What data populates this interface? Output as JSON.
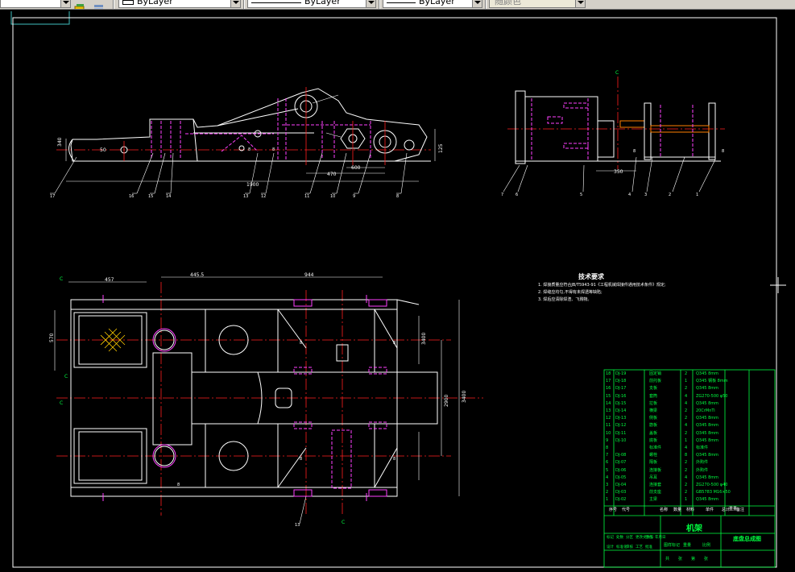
{
  "toolbar": {
    "layer_color_value": "ByLayer",
    "linetype_value": "ByLayer",
    "lineweight_value": "ByLayer",
    "plotstyle_value": "随颜色"
  },
  "drawing": {
    "dims_side": [
      "340",
      "50",
      "1900",
      "470",
      "600",
      "125"
    ],
    "dims_end": [
      "350"
    ],
    "dims_plan": [
      "457",
      "445.5",
      "944",
      "570",
      "3400",
      "2900",
      "3400"
    ],
    "item_labels_side": [
      "17",
      "16",
      "15",
      "14",
      "13",
      "12",
      "11",
      "10",
      "9",
      "8"
    ],
    "item_labels_end": [
      "7",
      "6",
      "5",
      "4",
      "3",
      "2",
      "1"
    ],
    "weld_marks": [
      "8",
      "8",
      "8",
      "8",
      "8",
      "8",
      "8",
      "8",
      "8"
    ],
    "plan_label": "13",
    "section_marks": [
      "C",
      "C",
      "C",
      "C",
      "C"
    ],
    "tech_title": "技术要求",
    "tech_notes": [
      "1. 焊接质量应符合JB/T5943-91《工程机械焊接件通用技术条件》规定;",
      "2. 焊缝应均匀,不得有未焊透等缺陷;",
      "3. 焊后应清除焊渣、飞溅物。"
    ]
  },
  "title_block": {
    "header": [
      "序号",
      "代号",
      "名称",
      "数量",
      "材料",
      "单件",
      "总计",
      "备注"
    ],
    "weight_head": "重量",
    "rows": [
      {
        "no": "18",
        "code": "DJ-19",
        "name": "固定销",
        "qty": "2",
        "mat": "Q345 8mm"
      },
      {
        "no": "17",
        "code": "DJ-18",
        "name": "前托板",
        "qty": "1",
        "mat": "Q345 钢板 8mm"
      },
      {
        "no": "16",
        "code": "DJ-17",
        "name": "支板",
        "qty": "2",
        "mat": "Q345 8mm"
      },
      {
        "no": "15",
        "code": "DJ-16",
        "name": "套筒",
        "qty": "4",
        "mat": "ZG270-500 φ50"
      },
      {
        "no": "14",
        "code": "DJ-15",
        "name": "拉板",
        "qty": "4",
        "mat": "Q345 8mm"
      },
      {
        "no": "13",
        "code": "DJ-14",
        "name": "横梁",
        "qty": "2",
        "mat": "20CrMnTi"
      },
      {
        "no": "12",
        "code": "DJ-13",
        "name": "侧板",
        "qty": "2",
        "mat": "Q345 8mm"
      },
      {
        "no": "11",
        "code": "DJ-12",
        "name": "筋板",
        "qty": "4",
        "mat": "Q345 8mm"
      },
      {
        "no": "10",
        "code": "DJ-11",
        "name": "盖板",
        "qty": "2",
        "mat": "Q345 8mm"
      },
      {
        "no": "9",
        "code": "DJ-10",
        "name": "底板",
        "qty": "1",
        "mat": "Q345 8mm"
      },
      {
        "no": "8",
        "code": "",
        "name": "标准件",
        "qty": "4",
        "mat": "标准件"
      },
      {
        "no": "7",
        "code": "DJ-08",
        "name": "螺栓",
        "qty": "8",
        "mat": "Q345 8mm"
      },
      {
        "no": "6",
        "code": "DJ-07",
        "name": "隔板",
        "qty": "2",
        "mat": "外购件"
      },
      {
        "no": "5",
        "code": "DJ-06",
        "name": "连接板",
        "qty": "2",
        "mat": "外购件"
      },
      {
        "no": "4",
        "code": "DJ-05",
        "name": "吊耳",
        "qty": "4",
        "mat": "Q345 8mm"
      },
      {
        "no": "3",
        "code": "DJ-04",
        "name": "连接套",
        "qty": "2",
        "mat": "ZG270-500 φ40"
      },
      {
        "no": "2",
        "code": "DJ-03",
        "name": "前支座",
        "qty": "2",
        "mat": "GB5783 M16×50"
      },
      {
        "no": "1",
        "code": "DJ-02",
        "name": "主梁",
        "qty": "1",
        "mat": "Q345 8mm"
      }
    ],
    "ratio_cells": [
      "图样标记",
      "重量",
      "比例"
    ],
    "part_name": "机架",
    "drawing_name": "底盘总成图",
    "signoff": [
      "标记",
      "处数",
      "分区",
      "更改文件号",
      "签名",
      "年月日",
      "设计",
      "标准化",
      "审核",
      "工艺",
      "批准"
    ],
    "sheet": [
      "共",
      "张",
      "第",
      "张"
    ]
  },
  "colors": {
    "background": "#000000",
    "outline": "#ffffff",
    "center_line": "#ff2020",
    "hidden_line": "#ff40ff",
    "dimension": "#ffffff",
    "title_block": "#00ff40",
    "marker": "#00ff00",
    "toolbar": "#d4d0c8"
  },
  "icons": [
    "layer-icon",
    "layer-states-icon",
    "properties-icon"
  ]
}
